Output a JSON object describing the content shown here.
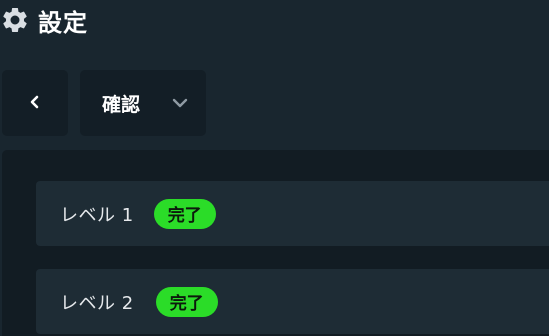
{
  "header": {
    "icon": "gear-icon",
    "title": "設定"
  },
  "toolbar": {
    "back_icon": "chevron-left-icon",
    "select_label": "確認",
    "select_icon": "chevron-down-icon"
  },
  "levels": [
    {
      "label": "レベル 1",
      "status": "完了"
    },
    {
      "label": "レベル 2",
      "status": "完了"
    }
  ],
  "colors": {
    "background": "#19262f",
    "panel": "#121c23",
    "row": "#1e2c35",
    "badge": "#2bdc28"
  }
}
